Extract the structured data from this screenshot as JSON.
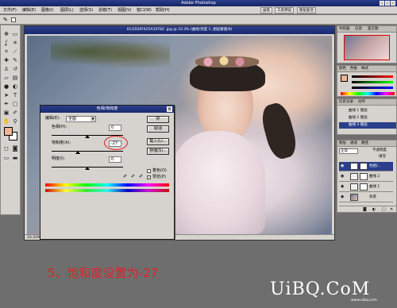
{
  "app": {
    "title": "Adobe Photoshop",
    "menus": [
      "文件(F)",
      "编辑(E)",
      "图像(I)",
      "图层(L)",
      "选择(S)",
      "滤镜(T)",
      "视图(V)",
      "窗口(W)",
      "帮助(H)"
    ],
    "workspace_tabs": [
      "画笔",
      "工具预设",
      "图层复合"
    ]
  },
  "document": {
    "title": "01/2020F425A10782 .jpg @ 33.3% (曲线/亮度 1, 图层蒙版/8)",
    "zoom": "33.33%"
  },
  "dialog": {
    "title": "色相/饱和度",
    "edit_label": "编辑(E):",
    "edit_value": "全图",
    "hue_label": "色相(H):",
    "hue_value": "0",
    "saturation_label": "饱和度(A):",
    "saturation_value": "-27",
    "lightness_label": "明度(I):",
    "lightness_value": "0",
    "ok_label": "好",
    "cancel_label": "取消",
    "load_label": "载入(L)...",
    "save_label": "存储(S)...",
    "colorize_label": "着色(O)",
    "preview_label": "预览(P)",
    "preview_checked": true,
    "colorize_checked": false
  },
  "panels": {
    "navigator_tabs": [
      "导航器",
      "信息",
      "直方图"
    ],
    "color_tabs": [
      "颜色",
      "色板",
      "样式"
    ],
    "history_tabs": [
      "历史记录",
      "动作"
    ],
    "history_items": [
      "曲线 1 图层",
      "曲线 2 图层",
      "曲线 3 图层"
    ],
    "layers_tabs": [
      "图层",
      "通道",
      "路径"
    ],
    "layers_blend": "正常",
    "layers_opacity_label": "不透明度",
    "layers_fill_label": "填充",
    "layers": [
      {
        "name": "色相/...",
        "selected": true
      },
      {
        "name": "曲线 2",
        "selected": false
      },
      {
        "name": "曲线 1",
        "selected": false
      },
      {
        "name": "背景",
        "selected": false
      }
    ]
  },
  "caption": "5、饱和度设置为-27",
  "watermark": "UiBQ.CoM",
  "watermark_sub": "www.uibq.com",
  "colors": {
    "foreground_swatch": "#f1b496",
    "background_swatch": "#ffffff",
    "caption": "#e0232a",
    "titlebar": "#2b3e8a"
  }
}
